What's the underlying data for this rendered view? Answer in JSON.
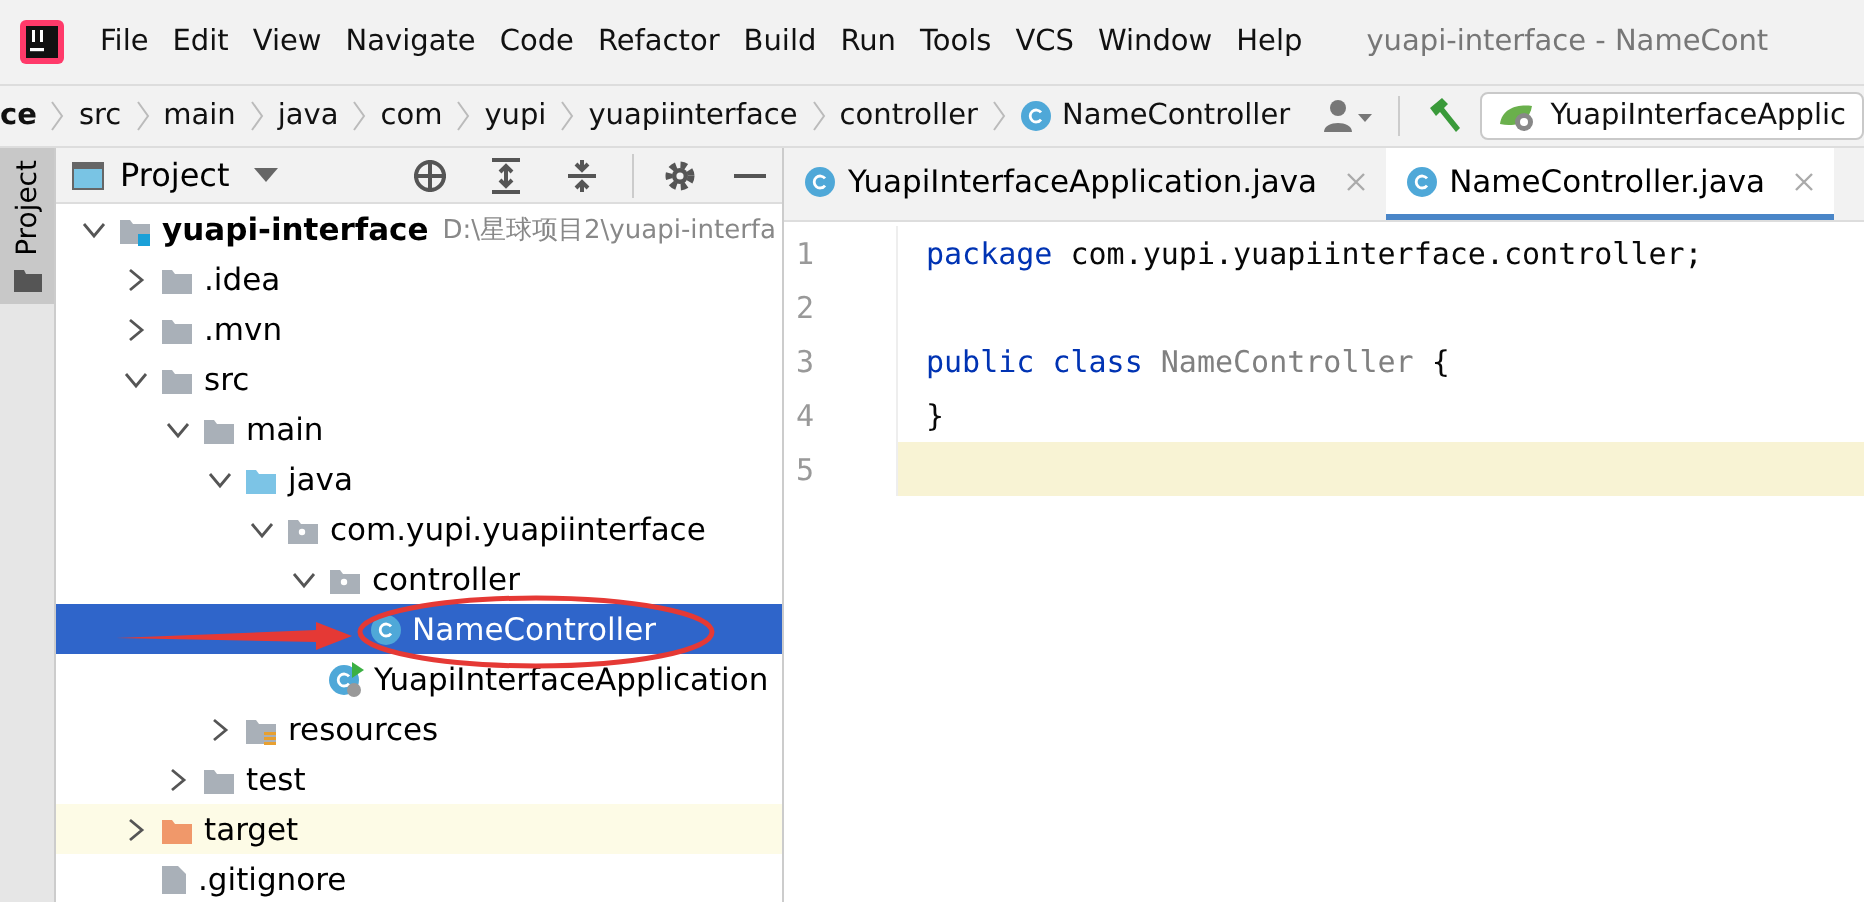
{
  "menu_bar": {
    "items": [
      {
        "label": "File"
      },
      {
        "label": "Edit"
      },
      {
        "label": "View"
      },
      {
        "label": "Navigate"
      },
      {
        "label": "Code"
      },
      {
        "label": "Refactor"
      },
      {
        "label": "Build"
      },
      {
        "label": "Run"
      },
      {
        "label": "Tools"
      },
      {
        "label": "VCS"
      },
      {
        "label": "Window"
      },
      {
        "label": "Help"
      }
    ],
    "title": "yuapi-interface - NameCont"
  },
  "nav_bar": {
    "breadcrumbs": [
      {
        "label": "ce",
        "kind": "folder"
      },
      {
        "label": "src",
        "kind": "folder"
      },
      {
        "label": "main",
        "kind": "folder"
      },
      {
        "label": "java",
        "kind": "folder"
      },
      {
        "label": "com",
        "kind": "folder"
      },
      {
        "label": "yupi",
        "kind": "folder"
      },
      {
        "label": "yuapiinterface",
        "kind": "folder"
      },
      {
        "label": "controller",
        "kind": "folder"
      },
      {
        "label": "NameController",
        "kind": "class"
      }
    ],
    "run_config": "YuapiInterfaceApplic"
  },
  "side_strip": {
    "label": "Project"
  },
  "project_panel": {
    "title": "Project",
    "tree": [
      {
        "name": "yuapi-interface",
        "kind": "module",
        "path": "D:\\星球项目2\\yuapi-interfa",
        "expanded": true,
        "selected": false,
        "children": [
          {
            "name": ".idea",
            "kind": "folder",
            "expanded": false,
            "selected": false
          },
          {
            "name": ".mvn",
            "kind": "folder",
            "expanded": false,
            "selected": false
          },
          {
            "name": "src",
            "kind": "folder",
            "expanded": true,
            "selected": false,
            "children": [
              {
                "name": "main",
                "kind": "folder",
                "expanded": true,
                "selected": false,
                "children": [
                  {
                    "name": "java",
                    "kind": "source",
                    "expanded": true,
                    "selected": false,
                    "children": [
                      {
                        "name": "com.yupi.yuapiinterface",
                        "kind": "package",
                        "expanded": true,
                        "selected": false,
                        "children": [
                          {
                            "name": "controller",
                            "kind": "package",
                            "expanded": true,
                            "selected": false,
                            "children": [
                              {
                                "name": "NameController",
                                "kind": "class",
                                "selected": true
                              }
                            ]
                          },
                          {
                            "name": "YuapiInterfaceApplication",
                            "kind": "app",
                            "selected": false
                          }
                        ]
                      }
                    ]
                  },
                  {
                    "name": "resources",
                    "kind": "resources",
                    "expanded": false,
                    "selected": false
                  }
                ]
              },
              {
                "name": "test",
                "kind": "folder",
                "expanded": false,
                "selected": false
              }
            ]
          },
          {
            "name": "target",
            "kind": "excluded",
            "expanded": false,
            "selected": false
          },
          {
            "name": ".gitignore",
            "kind": "file",
            "selected": false
          }
        ]
      }
    ]
  },
  "editor": {
    "tabs": [
      {
        "label": "YuapiInterfaceApplication.java",
        "selected": false
      },
      {
        "label": "NameController.java",
        "selected": true
      }
    ],
    "lines": [
      {
        "number": "1",
        "current": false,
        "tokens": [
          {
            "text": "package",
            "kind": "keyword"
          },
          {
            "text": " com.yupi.yuapiinterface.controller;",
            "kind": "plain"
          }
        ]
      },
      {
        "number": "2",
        "current": false
      },
      {
        "number": "3",
        "current": false,
        "tokens": [
          {
            "text": "public class",
            "kind": "keyword"
          },
          {
            "text": " NameController",
            "kind": "unused"
          },
          {
            "text": " {",
            "kind": "plain"
          }
        ]
      },
      {
        "number": "4",
        "current": false,
        "tokens": [
          {
            "text": "}",
            "kind": "plain"
          }
        ]
      },
      {
        "number": "5",
        "current": true
      }
    ]
  }
}
